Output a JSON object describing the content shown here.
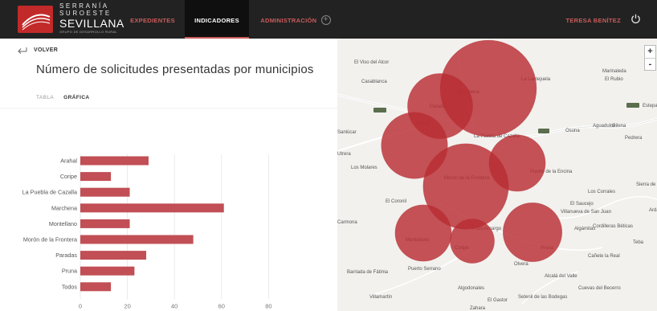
{
  "header": {
    "logo": {
      "line1": "SERRANÍA",
      "line2": "SUROESTE",
      "line3": "SEVILLANA",
      "line4": "GRUPO DE DESARROLLO RURAL"
    },
    "nav": [
      {
        "label": "EXPEDIENTES"
      },
      {
        "label": "INDICADORES"
      },
      {
        "label": "ADMINISTRACIÓN"
      }
    ],
    "user_name": "TERESA BENÍTEZ",
    "power_icon": "power-icon",
    "plus_icon": "plus-circle-icon",
    "accent": "#c95b5b"
  },
  "page": {
    "back_label": "VOLVER",
    "title": "Número de solicitudes presentadas por municipios",
    "tabs": [
      {
        "label": "TABLA",
        "active": false
      },
      {
        "label": "GRÁFICA",
        "active": true
      }
    ]
  },
  "chart_data": {
    "type": "bar",
    "orientation": "horizontal",
    "categories": [
      "Arahal",
      "Coripe",
      "La Puebla de Cazalla",
      "Marchena",
      "Montellano",
      "Morón de la Frontera",
      "Paradas",
      "Pruna",
      "Todos"
    ],
    "values": [
      29,
      13,
      21,
      61,
      21,
      48,
      28,
      23,
      13
    ],
    "xlim": [
      0,
      90
    ],
    "xticks": [
      0,
      20,
      40,
      60,
      80
    ],
    "bar_color": "#c14f55",
    "grid": true
  },
  "map": {
    "zoom_in": "+",
    "zoom_out": "-",
    "bubble_color": "#b82d33",
    "labels": [
      "El Viso del Alcor",
      "Casablanca",
      "La Lantejuela",
      "Marinaleda",
      "El Rubio",
      "Estepa",
      "Arahal",
      "Paradas",
      "Marchena",
      "La Puebla de Cazalla",
      "Osuna",
      "Aguadulce",
      "Gilena",
      "Pedrera",
      "Utrera",
      "Los Molares",
      "Puerto de la Encina",
      "Morón de la Frontera",
      "Los Corrales",
      "Sierra de Yeguas",
      "El Coronil",
      "El Saucejo",
      "Villanueva de San Juan",
      "Algámitas",
      "Cordilleras Béticas",
      "Teba",
      "Montellano",
      "Pozo Amargo",
      "Coripe",
      "Pruna",
      "Cañete la Real",
      "Olvera",
      "Alcalá del Valle",
      "Puerto Serrano",
      "Barriada de Fátima",
      "Algodonales",
      "Villamartín",
      "El Gastor",
      "Setenil de las Bodegas",
      "Cuevas del Becerro",
      "Zahara",
      "Sanlúcar",
      "Carmona",
      "Ardales"
    ]
  }
}
